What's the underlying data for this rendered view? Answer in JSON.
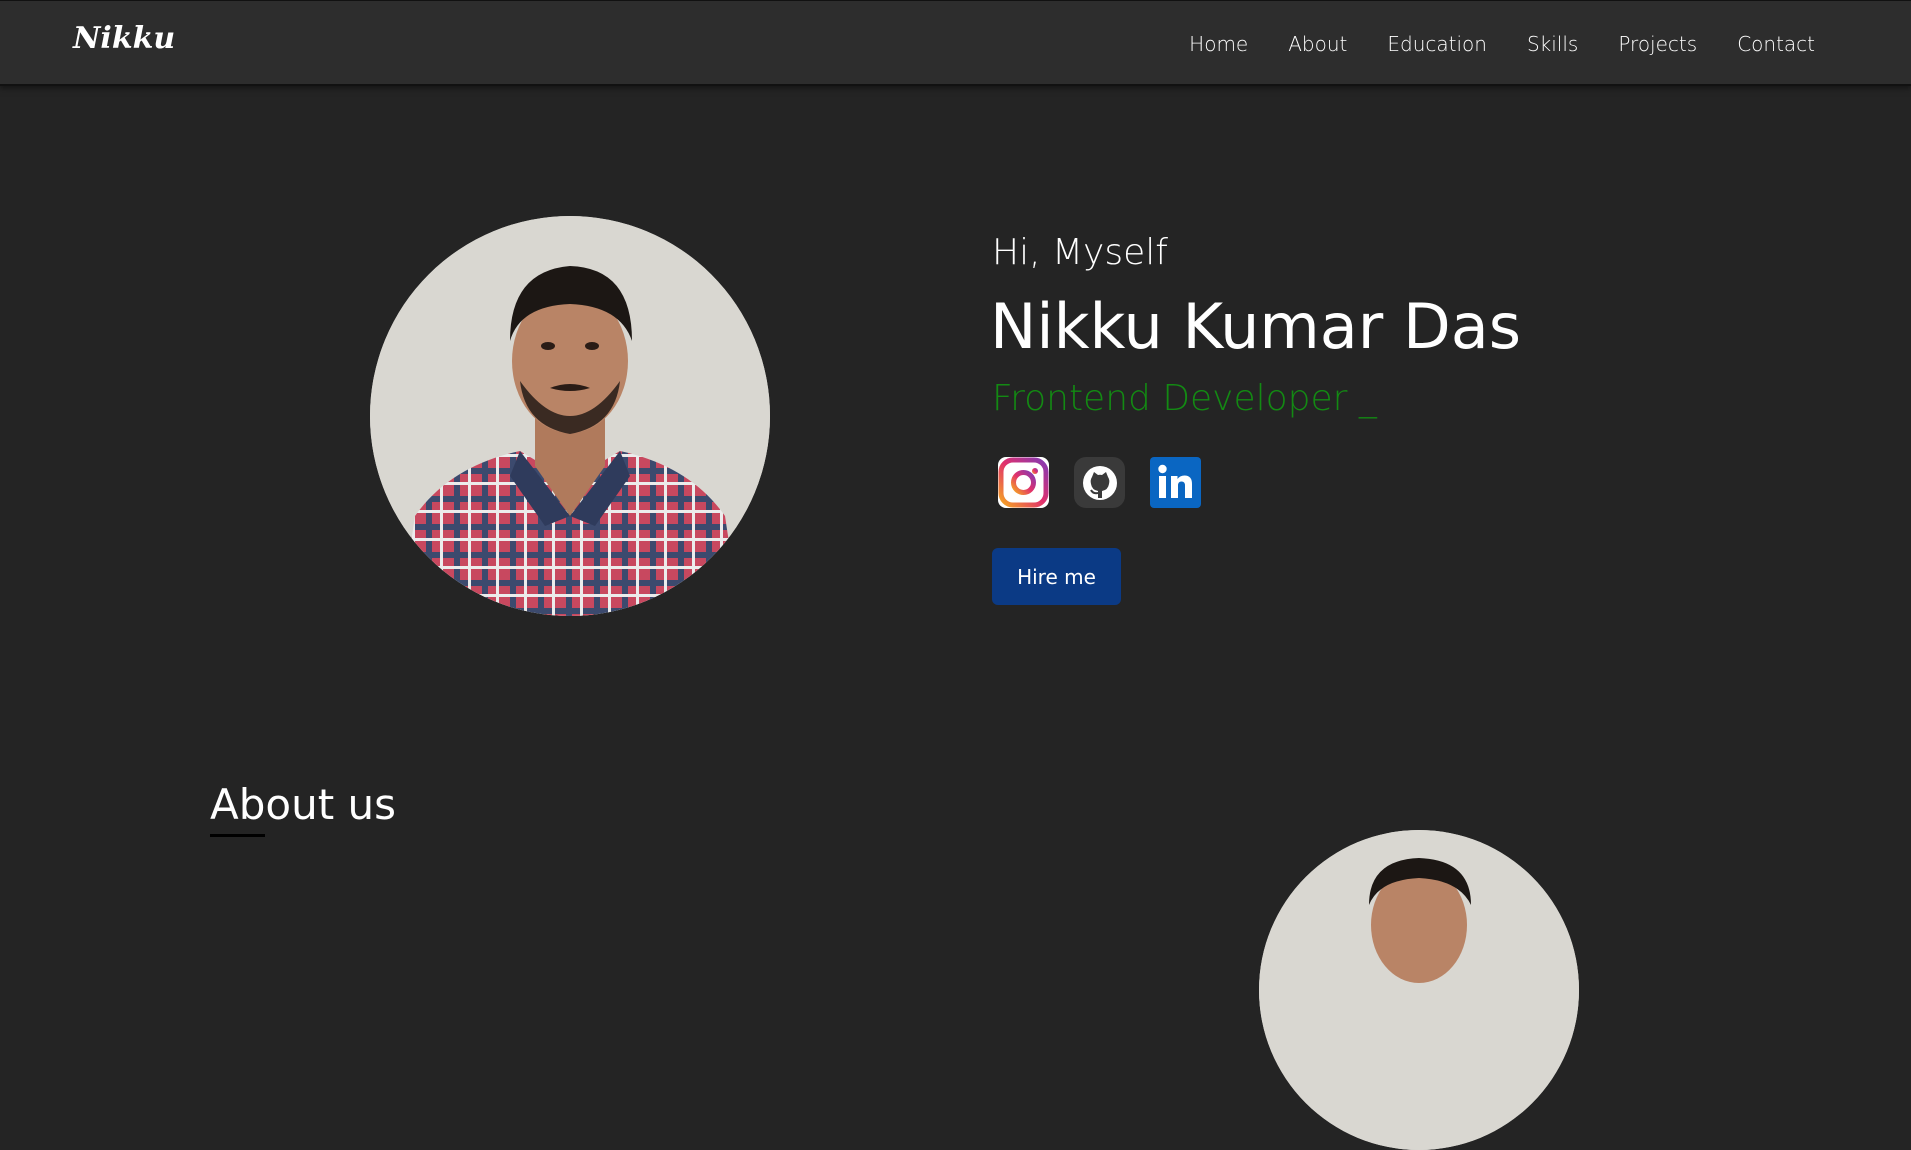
{
  "nav": {
    "logo": "Nikku",
    "links": [
      "Home",
      "About",
      "Education",
      "Skills",
      "Projects",
      "Contact"
    ]
  },
  "hero": {
    "greeting": "Hi, Myself",
    "name": "Nikku Kumar Das",
    "role": "Frontend Developer _",
    "role_color": "#138a13",
    "socials": [
      "instagram-icon",
      "github-icon",
      "linkedin-icon"
    ],
    "hire_label": "Hire me",
    "hire_color": "#0b3a85"
  },
  "about": {
    "title": "About us"
  }
}
